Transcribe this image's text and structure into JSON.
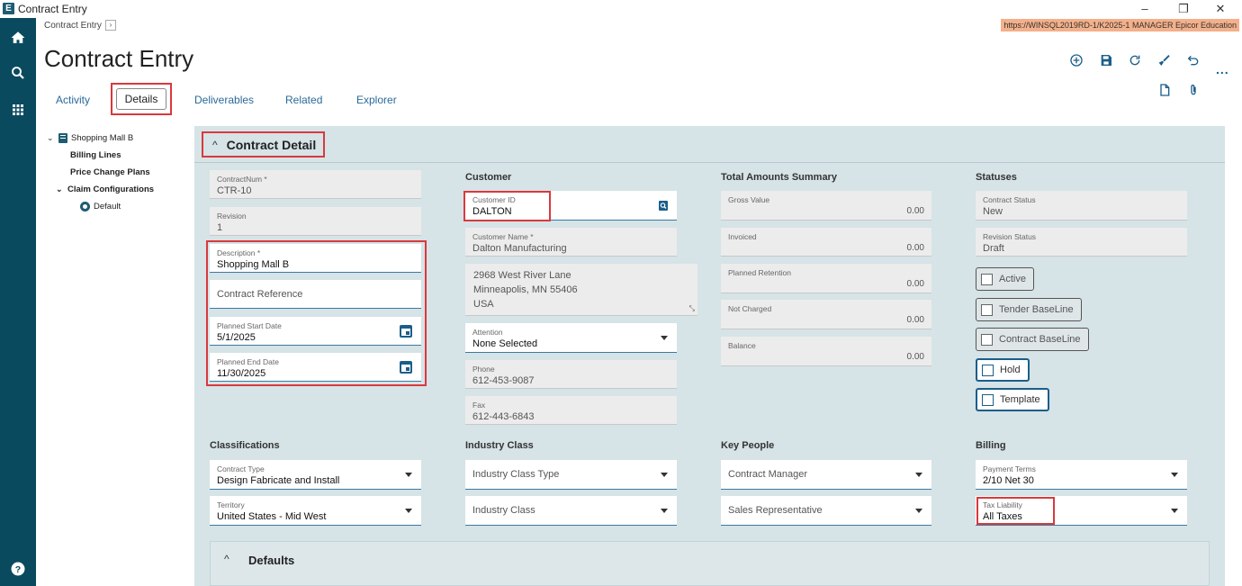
{
  "window": {
    "title": "Contract Entry",
    "app_icon_letter": "E",
    "minimize": "–",
    "restore": "❐",
    "close": "✕"
  },
  "breadcrumb": {
    "label": "Contract Entry",
    "chevron": "›"
  },
  "env": {
    "text": "https://WINSQL2019RD-1/K2025-1  MANAGER  Epicor Education"
  },
  "page": {
    "title": "Contract Entry"
  },
  "toolbar": {
    "more": "..."
  },
  "tabs": [
    {
      "label": "Activity"
    },
    {
      "label": "Details"
    },
    {
      "label": "Deliverables"
    },
    {
      "label": "Related"
    },
    {
      "label": "Explorer"
    }
  ],
  "tree": {
    "root": "Shopping Mall B",
    "billing_lines": "Billing Lines",
    "price_change_plans": "Price Change Plans",
    "claim_configurations": "Claim Configurations",
    "default": "Default"
  },
  "section": {
    "title": "Contract Detail"
  },
  "contract": {
    "contract_num_label": "ContractNum *",
    "contract_num": "CTR-10",
    "revision_label": "Revision",
    "revision": "1",
    "description_label": "Description *",
    "description": "Shopping Mall B",
    "contract_reference_placeholder": "Contract Reference",
    "start_label": "Planned Start Date",
    "start": "5/1/2025",
    "end_label": "Planned End Date",
    "end": "11/30/2025"
  },
  "customer": {
    "heading": "Customer",
    "id_label": "Customer ID",
    "id": "DALTON",
    "name_label": "Customer Name *",
    "name": "Dalton Manufacturing",
    "address": [
      "2968 West River Lane",
      "Minneapolis, MN  55406",
      "USA"
    ],
    "attention_label": "Attention",
    "attention": "None Selected",
    "phone_label": "Phone",
    "phone": "612-453-9087",
    "fax_label": "Fax",
    "fax": "612-443-6843"
  },
  "totals": {
    "heading": "Total Amounts Summary",
    "gross_label": "Gross Value",
    "gross": "0.00",
    "invoiced_label": "Invoiced",
    "invoiced": "0.00",
    "retention_label": "Planned Retention",
    "retention": "0.00",
    "not_charged_label": "Not Charged",
    "not_charged": "0.00",
    "balance_label": "Balance",
    "balance": "0.00"
  },
  "statuses": {
    "heading": "Statuses",
    "contract_status_label": "Contract Status",
    "contract_status": "New",
    "revision_status_label": "Revision Status",
    "revision_status": "Draft",
    "active": "Active",
    "tender_baseline": "Tender BaseLine",
    "contract_baseline": "Contract BaseLine",
    "hold": "Hold",
    "template": "Template"
  },
  "classifications": {
    "heading": "Classifications",
    "type_label": "Contract Type",
    "type": "Design Fabricate and Install",
    "territory_label": "Territory",
    "territory": "United States - Mid West"
  },
  "industry": {
    "heading": "Industry Class",
    "type_placeholder": "Industry Class Type",
    "class_placeholder": "Industry Class"
  },
  "key_people": {
    "heading": "Key People",
    "manager_placeholder": "Contract Manager",
    "rep_placeholder": "Sales Representative"
  },
  "billing": {
    "heading": "Billing",
    "terms_label": "Payment Terms",
    "terms": "2/10 Net 30",
    "tax_label": "Tax Liability",
    "tax": "All Taxes"
  },
  "defaults": {
    "title": "Defaults",
    "caret": "^"
  },
  "colors": {
    "rail": "#0a4a5e",
    "accent": "#1b5e8a",
    "highlight": "#d9393d",
    "panel": "#d6e3e7"
  }
}
